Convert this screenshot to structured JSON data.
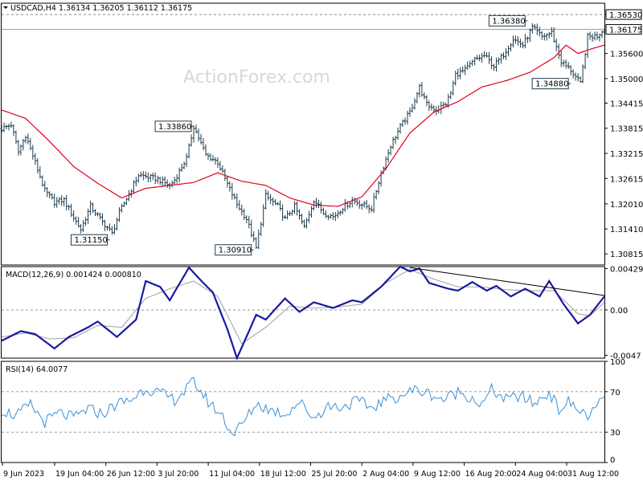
{
  "chart_data": [
    {
      "type": "line",
      "subtype": "ohlc-bars",
      "panel": "price",
      "title": "USDCAD,H4  1.36134 1.36205 1.36112 1.36175",
      "watermark": "ActionForex.com",
      "ylim": [
        1.3055,
        1.368
      ],
      "y_ticks": [
        "1.36530",
        "1.35600",
        "1.35000",
        "1.34415",
        "1.33815",
        "1.33215",
        "1.32615",
        "1.32010",
        "1.31410",
        "1.30815"
      ],
      "last_price": "1.36175",
      "current_level": "1.36530",
      "x_ticks": [
        "9 Jun 2023",
        "19 Jun 04:00",
        "26 Jun 12:00",
        "3 Jul 20:00",
        "11 Jul 04:00",
        "18 Jul 12:00",
        "25 Jul 20:00",
        "2 Aug 04:00",
        "9 Aug 12:00",
        "16 Aug 20:00",
        "24 Aug 04:00",
        "31 Aug 12:00"
      ],
      "annotations": [
        "1.33860",
        "1.31150",
        "1.30910",
        "1.36380",
        "1.34880"
      ],
      "series": [
        {
          "role": "price-close",
          "x": [
            0,
            4,
            7,
            10,
            14,
            18,
            22,
            26,
            30,
            33,
            37,
            41,
            46,
            49,
            53,
            57,
            61,
            65,
            70,
            72,
            77,
            80,
            85,
            90,
            94,
            98,
            102,
            106,
            110,
            115,
            118,
            122,
            126,
            130,
            134,
            138,
            142,
            146,
            150,
            154,
            158,
            162,
            166,
            170,
            174,
            177,
            181,
            185,
            187,
            189,
            193,
            197,
            201,
            205,
            209,
            213,
            217,
            221,
            225,
            229,
            233,
            237,
            241,
            244,
            248,
            251
          ],
          "values": [
            1.338,
            1.339,
            1.3325,
            1.3365,
            1.33,
            1.3232,
            1.3205,
            1.321,
            1.3168,
            1.314,
            1.3195,
            1.3165,
            1.313,
            1.318,
            1.3225,
            1.327,
            1.3265,
            1.326,
            1.3245,
            1.3258,
            1.331,
            1.3386,
            1.3318,
            1.33,
            1.3248,
            1.32,
            1.3165,
            1.3095,
            1.322,
            1.3195,
            1.3165,
            1.3195,
            1.3145,
            1.321,
            1.318,
            1.317,
            1.3192,
            1.321,
            1.32,
            1.319,
            1.3275,
            1.334,
            1.3385,
            1.342,
            1.348,
            1.3438,
            1.3425,
            1.344,
            1.3465,
            1.351,
            1.352,
            1.3545,
            1.3555,
            1.353,
            1.3558,
            1.3595,
            1.358,
            1.3622,
            1.36,
            1.361,
            1.354,
            1.352,
            1.3488,
            1.36,
            1.3602,
            1.362
          ]
        },
        {
          "name": "SMA",
          "role": "moving-average",
          "color": "#e0001a",
          "x": [
            0,
            10,
            20,
            30,
            40,
            50,
            60,
            70,
            80,
            90,
            100,
            110,
            120,
            130,
            140,
            150,
            160,
            170,
            180,
            190,
            200,
            210,
            220,
            230,
            235,
            240,
            245,
            251
          ],
          "values": [
            1.3425,
            1.3405,
            1.335,
            1.329,
            1.325,
            1.3215,
            1.3238,
            1.3245,
            1.3252,
            1.3275,
            1.3255,
            1.3245,
            1.3215,
            1.3198,
            1.3195,
            1.3218,
            1.3285,
            1.337,
            1.342,
            1.3445,
            1.348,
            1.3495,
            1.3515,
            1.355,
            1.358,
            1.356,
            1.357,
            1.358
          ]
        }
      ]
    },
    {
      "type": "line",
      "panel": "macd",
      "title": "MACD(12,26,9) 0.001424 0.000810",
      "ylim": [
        -0.005,
        0.0045
      ],
      "y_ticks": [
        "0.00429",
        "0.00",
        "-0.0047"
      ],
      "series": [
        {
          "name": "MACD",
          "color": "#1a1aa0",
          "x": [
            0,
            8,
            14,
            22,
            28,
            36,
            40,
            48,
            56,
            60,
            66,
            70,
            78,
            84,
            88,
            94,
            98,
            106,
            110,
            118,
            124,
            130,
            138,
            146,
            150,
            158,
            166,
            170,
            174,
            178,
            186,
            190,
            196,
            202,
            206,
            212,
            218,
            224,
            228,
            234,
            240,
            245,
            251
          ],
          "values": [
            -0.0032,
            -0.0022,
            -0.0025,
            -0.004,
            -0.0028,
            -0.0018,
            -0.0012,
            -0.0028,
            -0.001,
            0.003,
            0.0024,
            0.001,
            0.0044,
            0.0028,
            0.0018,
            -0.002,
            -0.005,
            -0.0005,
            -0.001,
            0.0012,
            -0.0002,
            0.0008,
            0.0002,
            0.001,
            0.0008,
            0.0024,
            0.0045,
            0.004,
            0.0043,
            0.0028,
            0.0022,
            0.002,
            0.0029,
            0.002,
            0.0025,
            0.0014,
            0.0022,
            0.0014,
            0.003,
            0.0006,
            -0.0014,
            -0.0005,
            0.0014
          ]
        },
        {
          "name": "Signal",
          "color": "#a0a0a0",
          "x": [
            0,
            10,
            20,
            30,
            40,
            50,
            60,
            70,
            80,
            90,
            100,
            110,
            120,
            130,
            140,
            150,
            160,
            170,
            180,
            190,
            200,
            210,
            220,
            230,
            240,
            245,
            251
          ],
          "values": [
            -0.0028,
            -0.0024,
            -0.003,
            -0.0029,
            -0.0016,
            -0.0018,
            0.0012,
            0.0022,
            0.003,
            0.0014,
            -0.0035,
            -0.0018,
            0.0004,
            0.0002,
            0.0003,
            0.0006,
            0.0028,
            0.0042,
            0.0032,
            0.0024,
            0.0024,
            0.0021,
            0.002,
            0.002,
            -0.0004,
            -0.0006,
            0.0008
          ]
        }
      ],
      "trendline": {
        "x": [
          170,
          251
        ],
        "values": [
          0.0044,
          0.0015
        ]
      }
    },
    {
      "type": "line",
      "panel": "rsi",
      "title": "RSI(14) 64.0077",
      "ylim": [
        0,
        100
      ],
      "y_ticks": [
        "100",
        "70",
        "30",
        "0"
      ],
      "levels": [
        70,
        30
      ],
      "series": [
        {
          "name": "RSI",
          "color": "#3c8fd6",
          "x": [
            0,
            6,
            12,
            18,
            24,
            30,
            36,
            42,
            48,
            54,
            60,
            66,
            72,
            76,
            80,
            86,
            92,
            96,
            100,
            106,
            112,
            118,
            124,
            130,
            136,
            142,
            148,
            154,
            160,
            166,
            172,
            178,
            184,
            190,
            196,
            200,
            204,
            210,
            216,
            222,
            228,
            232,
            236,
            240,
            245,
            251
          ],
          "values": [
            52,
            46,
            57,
            40,
            49,
            44,
            53,
            48,
            58,
            62,
            74,
            68,
            62,
            70,
            80,
            60,
            46,
            28,
            37,
            58,
            52,
            48,
            60,
            44,
            56,
            55,
            61,
            54,
            62,
            66,
            72,
            68,
            62,
            70,
            64,
            56,
            72,
            62,
            66,
            58,
            70,
            52,
            60,
            52,
            46,
            64
          ]
        }
      ]
    }
  ]
}
